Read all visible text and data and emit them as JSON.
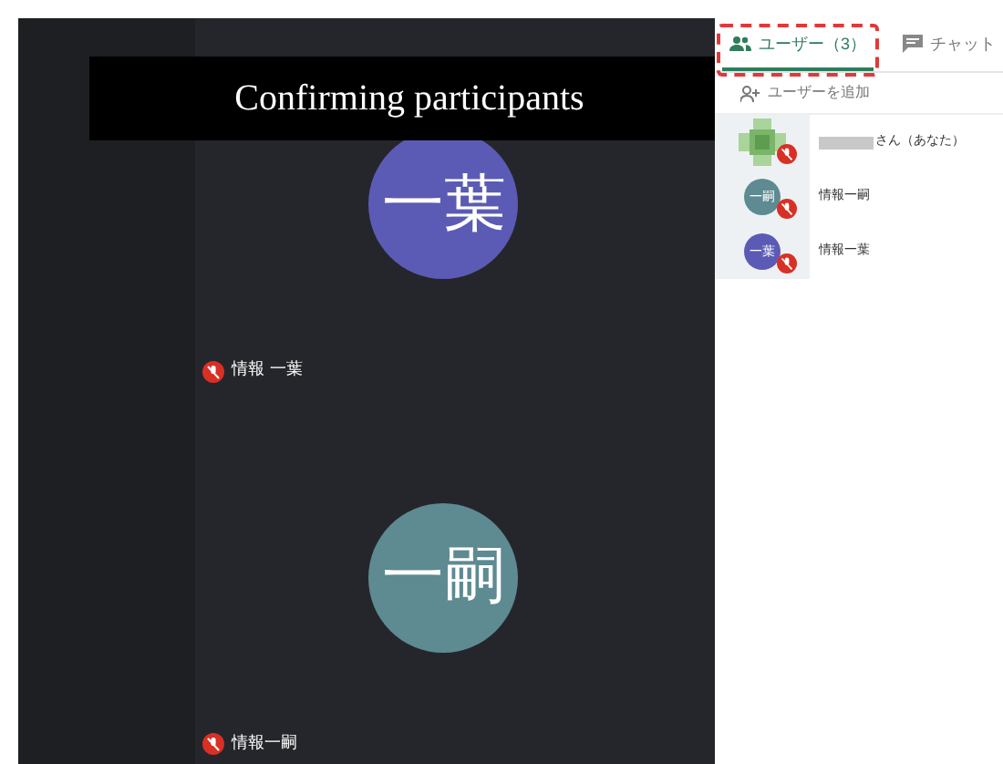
{
  "caption": "Confirming participants",
  "tiles": [
    {
      "initials": "一葉",
      "color": "#5b5bb5",
      "name": "情報 一葉",
      "muted": true
    },
    {
      "initials": "一嗣",
      "color": "#5e8a92",
      "name": "情報一嗣",
      "muted": true
    }
  ],
  "tabs": [
    {
      "label": "ユーザー（3）",
      "kind": "users",
      "selected": true,
      "highlighted": true
    },
    {
      "label": "チャット",
      "kind": "chat",
      "selected": false,
      "highlighted": false
    }
  ],
  "add_user": "ユーザーを追加",
  "users": [
    {
      "kind": "self",
      "name": "さん（あなた）",
      "muted": true
    },
    {
      "kind": "avatar",
      "initials": "一嗣",
      "color": "#5e8a92",
      "name": "情報一嗣",
      "muted": true
    },
    {
      "kind": "avatar",
      "initials": "一葉",
      "color": "#5b5bb5",
      "name": "情報一葉",
      "muted": true
    }
  ]
}
